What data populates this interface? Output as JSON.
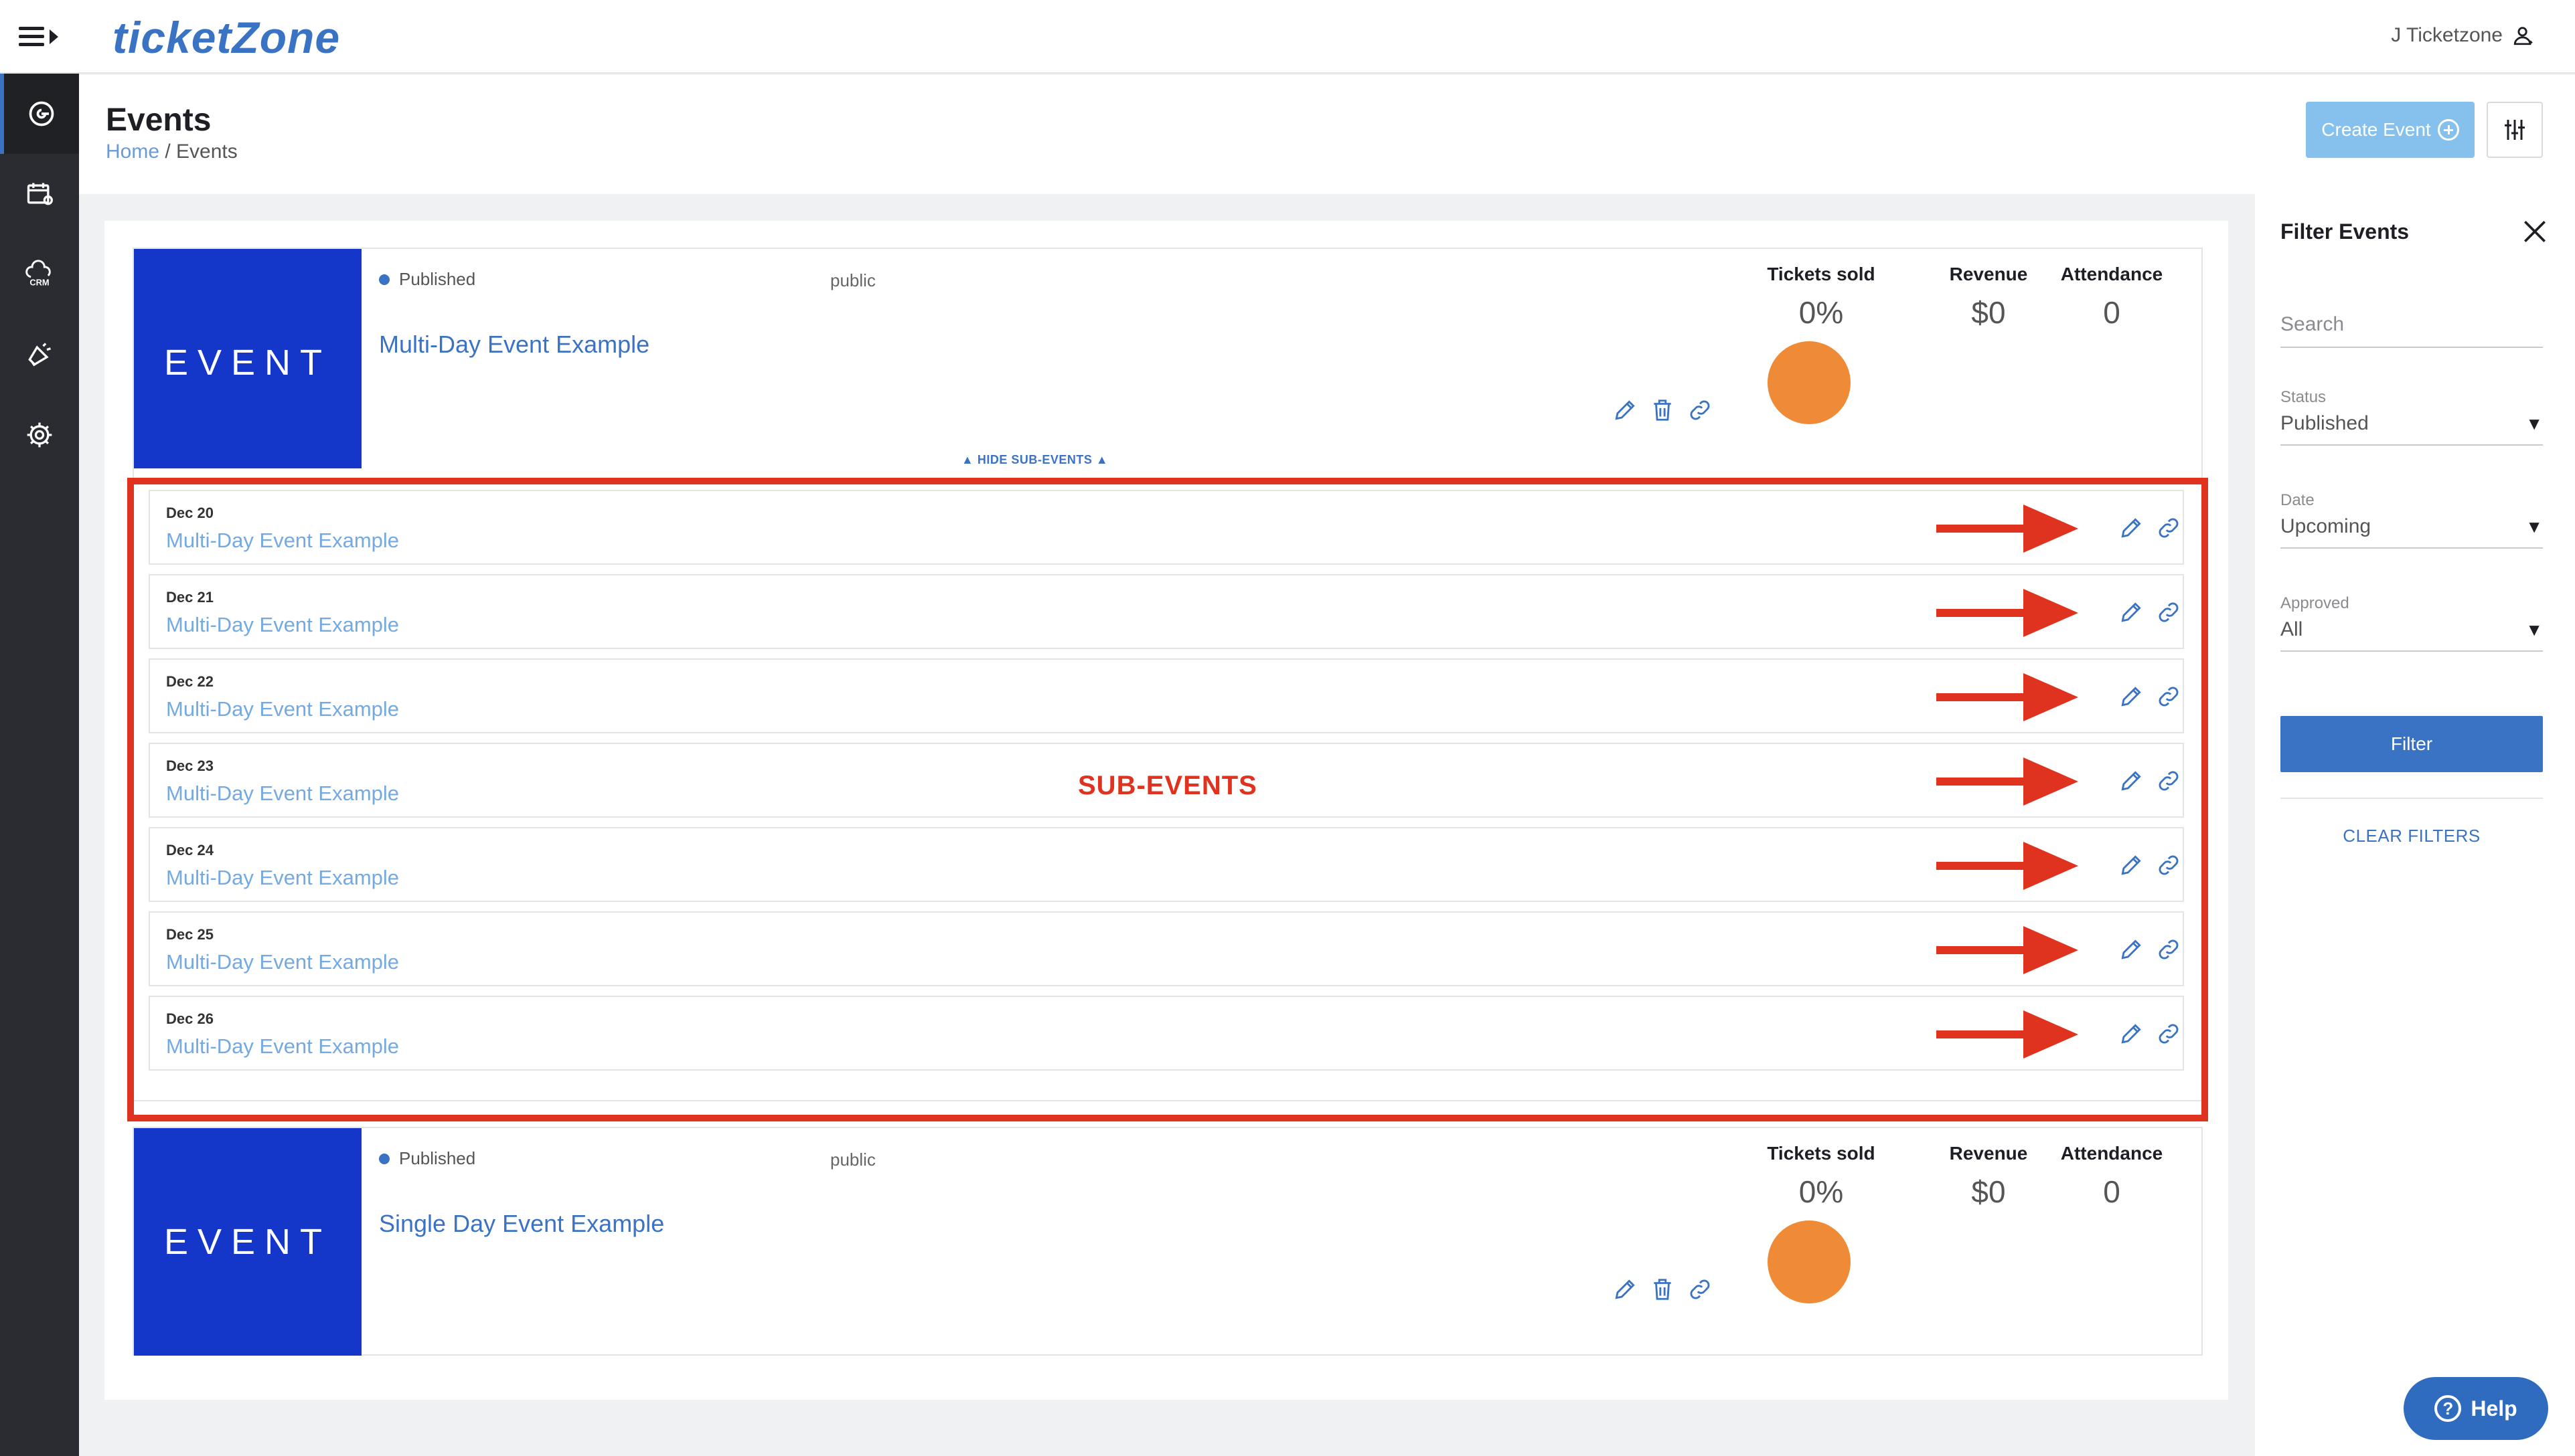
{
  "app": {
    "logo": "ticketZone",
    "user_name": "J Ticketzone"
  },
  "header": {
    "title": "Events",
    "breadcrumb_home": "Home",
    "breadcrumb_separator": " / ",
    "breadcrumb_current": "Events",
    "create_button": "Create Event"
  },
  "events": [
    {
      "thumb_text": "EVENT",
      "status": "Published",
      "visibility": "public",
      "name": "Multi-Day Event Example",
      "tickets_sold_label": "Tickets sold",
      "tickets_sold": "0%",
      "revenue_label": "Revenue",
      "revenue": "$0",
      "attendance_label": "Attendance",
      "attendance": "0"
    },
    {
      "thumb_text": "EVENT",
      "status": "Published",
      "visibility": "public",
      "name": "Single Day Event Example",
      "tickets_sold_label": "Tickets sold",
      "tickets_sold": "0%",
      "revenue_label": "Revenue",
      "revenue": "$0",
      "attendance_label": "Attendance",
      "attendance": "0"
    }
  ],
  "hide_sub_events": "▲ HIDE SUB-EVENTS ▲",
  "sub_events": [
    {
      "date": "Dec 20",
      "name": "Multi-Day Event Example"
    },
    {
      "date": "Dec 21",
      "name": "Multi-Day Event Example"
    },
    {
      "date": "Dec 22",
      "name": "Multi-Day Event Example"
    },
    {
      "date": "Dec 23",
      "name": "Multi-Day Event Example"
    },
    {
      "date": "Dec 24",
      "name": "Multi-Day Event Example"
    },
    {
      "date": "Dec 25",
      "name": "Multi-Day Event Example"
    },
    {
      "date": "Dec 26",
      "name": "Multi-Day Event Example"
    }
  ],
  "annotation": {
    "label": "SUB-EVENTS",
    "color": "#e0331f"
  },
  "filter": {
    "title": "Filter Events",
    "search_placeholder": "Search",
    "status_label": "Status",
    "status_value": "Published",
    "date_label": "Date",
    "date_value": "Upcoming",
    "approved_label": "Approved",
    "approved_value": "All",
    "filter_button": "Filter",
    "clear_button": "CLEAR FILTERS"
  },
  "help_button": "Help",
  "colors": {
    "accent": "#3b73c4",
    "sidebar": "#2a2c31",
    "thumb": "#1436c9",
    "donut": "#ef8a36"
  }
}
